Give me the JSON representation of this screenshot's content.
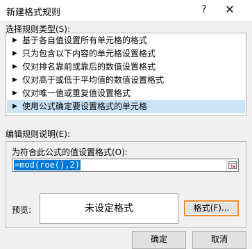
{
  "window": {
    "title": "新建格式规则",
    "help_label": "?",
    "close_label": "✕"
  },
  "rule_type": {
    "label": "选择规则类型(S):",
    "items": [
      {
        "label": "基于各自值设置所有单元格的格式",
        "selected": false
      },
      {
        "label": "只为包含以下内容的单元格设置格式",
        "selected": false
      },
      {
        "label": "仅对排名靠前或靠后的数值设置格式",
        "selected": false
      },
      {
        "label": "仅对高于或低于平均值的数值设置格式",
        "selected": false
      },
      {
        "label": "仅对唯一值或重复值设置格式",
        "selected": false
      },
      {
        "label": "使用公式确定要设置格式的单元格",
        "selected": true
      }
    ]
  },
  "edit_rule": {
    "label": "编辑规则说明(E):",
    "formula_label": "为符合此公式的值设置格式(O):",
    "formula_value": "=mod(roe(),2)",
    "preview_label": "预览:",
    "preview_text": "未设定格式",
    "format_button": "格式(F)..."
  },
  "footer": {
    "ok_button": "确定",
    "cancel_button": "取消"
  },
  "colors": {
    "selection": "#0078d7",
    "highlight_row": "#cce4f7",
    "focus_border": "#f08a2c"
  }
}
